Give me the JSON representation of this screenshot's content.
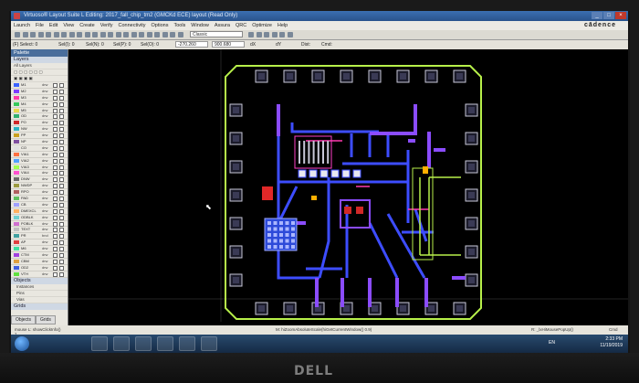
{
  "window": {
    "title": "Virtuoso® Layout Suite L Editing: 2017_fall_chip_tm2 (GMCKd ECE) layout (Read Only)"
  },
  "menubar": {
    "items": [
      "Launch",
      "File",
      "Edit",
      "View",
      "Create",
      "Verify",
      "Connectivity",
      "Options",
      "Tools",
      "Window",
      "Assura",
      "QRC",
      "Optimize",
      "Help"
    ],
    "brand": "cādence"
  },
  "toolbar": {
    "search_value": "Classic"
  },
  "coordbar": {
    "sel": "(F) Select: 0",
    "sel1": "Sel(I): 0",
    "sel2": "Sel(N): 0",
    "sel3": "Sel(P): 0",
    "sel4": "Sel(O): 0",
    "x_value": "-270.260",
    "y_value": "900.680",
    "dx": "dX",
    "dy": "dY",
    "dist": "Dist:",
    "cmd": "Cmd:"
  },
  "palette": {
    "title": "Palette",
    "layers_section": "Layers",
    "filter_placeholder": "All Layers",
    "layers": [
      {
        "name": "M1",
        "purpose": "drw",
        "color": "#3a62ff"
      },
      {
        "name": "M2",
        "purpose": "drw",
        "color": "#7d3cff"
      },
      {
        "name": "M3",
        "purpose": "drw",
        "color": "#ff3aa8"
      },
      {
        "name": "M4",
        "purpose": "drw",
        "color": "#34c759"
      },
      {
        "name": "M5",
        "purpose": "drw",
        "color": "#e6d84a"
      },
      {
        "name": "OD",
        "purpose": "drw",
        "color": "#30b070"
      },
      {
        "name": "PO",
        "purpose": "drw",
        "color": "#d02828"
      },
      {
        "name": "NW",
        "purpose": "drw",
        "color": "#2bb3c0"
      },
      {
        "name": "PP",
        "purpose": "drw",
        "color": "#c8a020"
      },
      {
        "name": "NP",
        "purpose": "drw",
        "color": "#8050a0"
      },
      {
        "name": "CO",
        "purpose": "drw",
        "color": "#e0e0e0"
      },
      {
        "name": "VIA1",
        "purpose": "drw",
        "color": "#ff7040"
      },
      {
        "name": "VIA2",
        "purpose": "drw",
        "color": "#50a0ff"
      },
      {
        "name": "VIA3",
        "purpose": "drw",
        "color": "#a0ff50"
      },
      {
        "name": "VIA4",
        "purpose": "drw",
        "color": "#ff50d0"
      },
      {
        "name": "DNW",
        "purpose": "drw",
        "color": "#6a6a6a"
      },
      {
        "name": "NWDP",
        "purpose": "drw",
        "color": "#9a9a40"
      },
      {
        "name": "RPO",
        "purpose": "drw",
        "color": "#b06060"
      },
      {
        "name": "PAD",
        "purpose": "drw",
        "color": "#60c060"
      },
      {
        "name": "CB",
        "purpose": "drw",
        "color": "#a0a0ff"
      },
      {
        "name": "DMEXCL",
        "purpose": "drw",
        "color": "#ffb060"
      },
      {
        "name": "ODBLK",
        "purpose": "drw",
        "color": "#70d0d0"
      },
      {
        "name": "POBLK",
        "purpose": "drw",
        "color": "#d070d0"
      },
      {
        "name": "TEXT",
        "purpose": "drw",
        "color": "#c0c0c0"
      },
      {
        "name": "PR",
        "purpose": "bnd",
        "color": "#40a0a0"
      },
      {
        "name": "AP",
        "purpose": "drw",
        "color": "#e04040"
      },
      {
        "name": "M6",
        "purpose": "drw",
        "color": "#40e0a0"
      },
      {
        "name": "CTM",
        "purpose": "drw",
        "color": "#a040e0"
      },
      {
        "name": "CBM",
        "purpose": "drw",
        "color": "#e0a040"
      },
      {
        "name": "OD2",
        "purpose": "drw",
        "color": "#4060e0"
      },
      {
        "name": "VTH",
        "purpose": "drw",
        "color": "#60e040"
      }
    ],
    "objects_section": "Objects",
    "objects": [
      "Instances",
      "Pins",
      "Vias"
    ],
    "grids_section": "Grids",
    "tabs": [
      "Objects",
      "Grids"
    ]
  },
  "status": {
    "mouse": "mouse L: showClickInfo()",
    "middle": "M: hiZoomAbsoluteScale(hiGetCurrentWindow() 0.9)",
    "right": "R: _lxHiMousePopUp()",
    "cmd": "Cmd",
    "page": "1"
  },
  "taskbar": {
    "lang": "EN",
    "time": "2:33 PM",
    "date": "11/19/2019"
  },
  "monitor": {
    "brand": "DELL"
  }
}
